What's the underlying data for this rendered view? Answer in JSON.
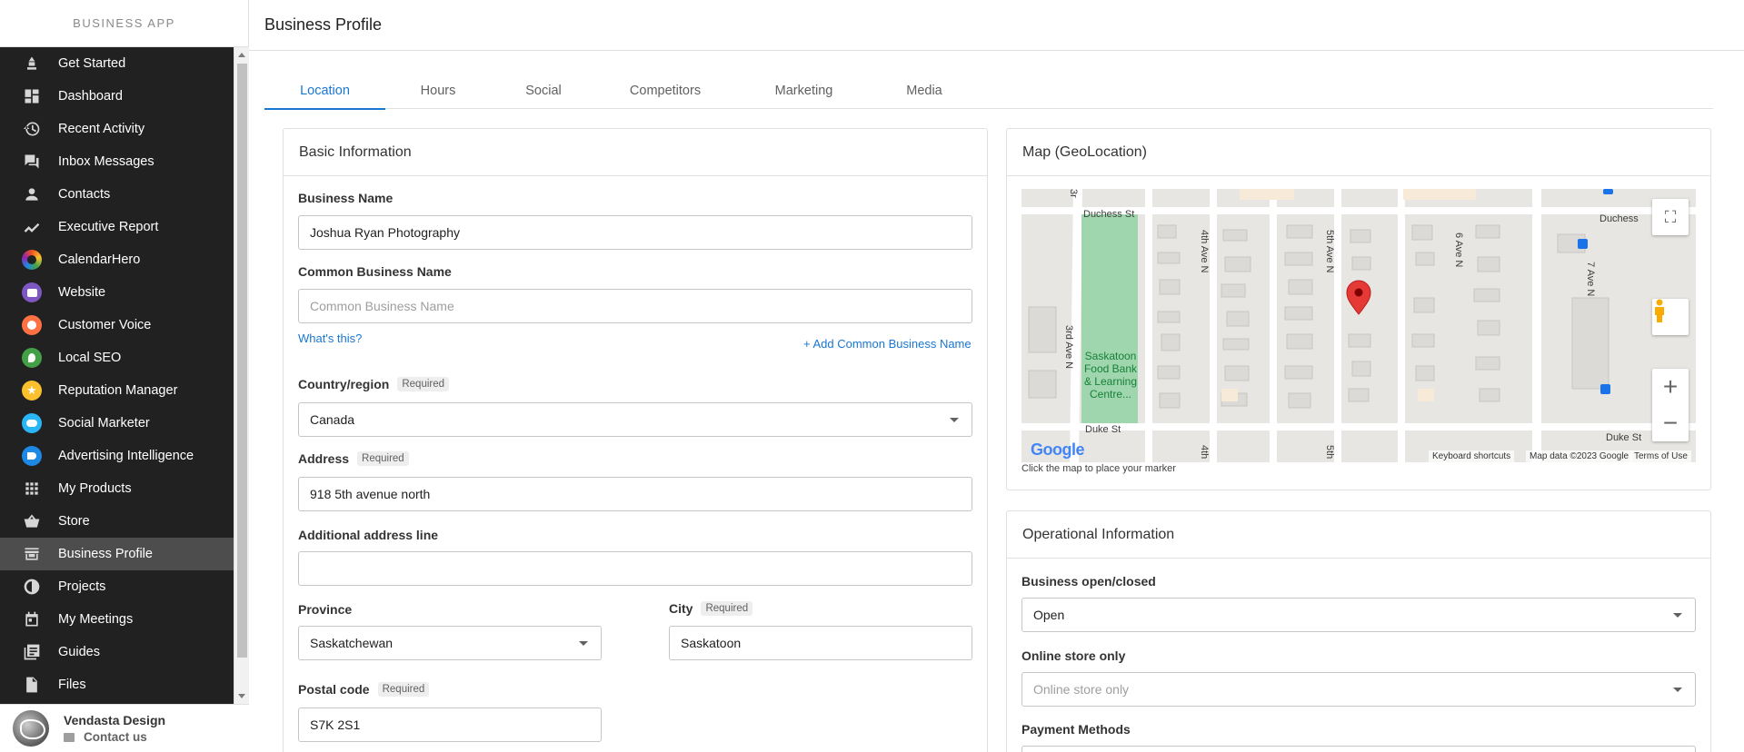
{
  "brand": "BUSINESS APP",
  "page_title": "Business Profile",
  "nav": [
    {
      "label": "Get Started",
      "icon": "rocket-icon"
    },
    {
      "label": "Dashboard",
      "icon": "dashboard-icon"
    },
    {
      "label": "Recent Activity",
      "icon": "history-icon"
    },
    {
      "label": "Inbox Messages",
      "icon": "forum-icon"
    },
    {
      "label": "Contacts",
      "icon": "person-icon"
    },
    {
      "label": "Executive Report",
      "icon": "trending-line-icon"
    },
    {
      "label": "CalendarHero",
      "icon": "calendarhero-icon"
    },
    {
      "label": "Website",
      "icon": "website-icon"
    },
    {
      "label": "Customer Voice",
      "icon": "customer-voice-icon"
    },
    {
      "label": "Local SEO",
      "icon": "local-seo-icon"
    },
    {
      "label": "Reputation Manager",
      "icon": "star-icon"
    },
    {
      "label": "Social Marketer",
      "icon": "social-marketer-icon"
    },
    {
      "label": "Advertising Intelligence",
      "icon": "megaphone-icon"
    },
    {
      "label": "My Products",
      "icon": "apps-grid-icon"
    },
    {
      "label": "Store",
      "icon": "basket-icon"
    },
    {
      "label": "Business Profile",
      "icon": "storefront-icon"
    },
    {
      "label": "Projects",
      "icon": "projects-icon"
    },
    {
      "label": "My Meetings",
      "icon": "calendar-icon"
    },
    {
      "label": "Guides",
      "icon": "library-icon"
    },
    {
      "label": "Files",
      "icon": "file-icon"
    }
  ],
  "user": {
    "name": "Vendasta Design",
    "contact_label": "Contact us"
  },
  "tabs": [
    "Location",
    "Hours",
    "Social",
    "Competitors",
    "Marketing",
    "Media"
  ],
  "basic": {
    "title": "Basic Information",
    "business_name_label": "Business Name",
    "business_name_value": "Joshua Ryan Photography",
    "common_name_label": "Common Business Name",
    "common_name_placeholder": "Common Business Name",
    "whats_this": "What's this?",
    "add_common_name": "+ Add Common Business Name",
    "country_label": "Country/region",
    "country_value": "Canada",
    "address_label": "Address",
    "address_value": "918 5th avenue north",
    "additional_label": "Additional address line",
    "additional_value": "",
    "province_label": "Province",
    "province_value": "Saskatchewan",
    "city_label": "City",
    "city_value": "Saskatoon",
    "postal_label": "Postal code",
    "postal_value": "S7K 2S1",
    "required": "Required"
  },
  "map": {
    "title": "Map (GeoLocation)",
    "hint": "Click the map to place your marker",
    "streets": [
      "Duchess St",
      "Duke St",
      "4th Ave N",
      "5th Ave N",
      "6 Ave N",
      "7 Ave N",
      "3rd Ave N",
      "Duchess",
      "Duke St",
      "3r",
      "4th",
      "5th"
    ],
    "poi": [
      "Saskatoon",
      "Food Bank",
      "& Learning",
      "Centre..."
    ],
    "logo": "Google",
    "keyboard": "Keyboard shortcuts",
    "mapdata": "Map data ©2023 Google",
    "terms": "Terms of Use"
  },
  "ops": {
    "title": "Operational Information",
    "open_label": "Business open/closed",
    "open_value": "Open",
    "online_label": "Online store only",
    "online_placeholder": "Online store only",
    "payment_label": "Payment Methods"
  },
  "colors": {
    "accent": "#1976d2",
    "sidebar_bg": "#212121",
    "active_item": "#4d4d4d",
    "map_park": "#9fd6ad",
    "map_marker": "#e53935"
  }
}
